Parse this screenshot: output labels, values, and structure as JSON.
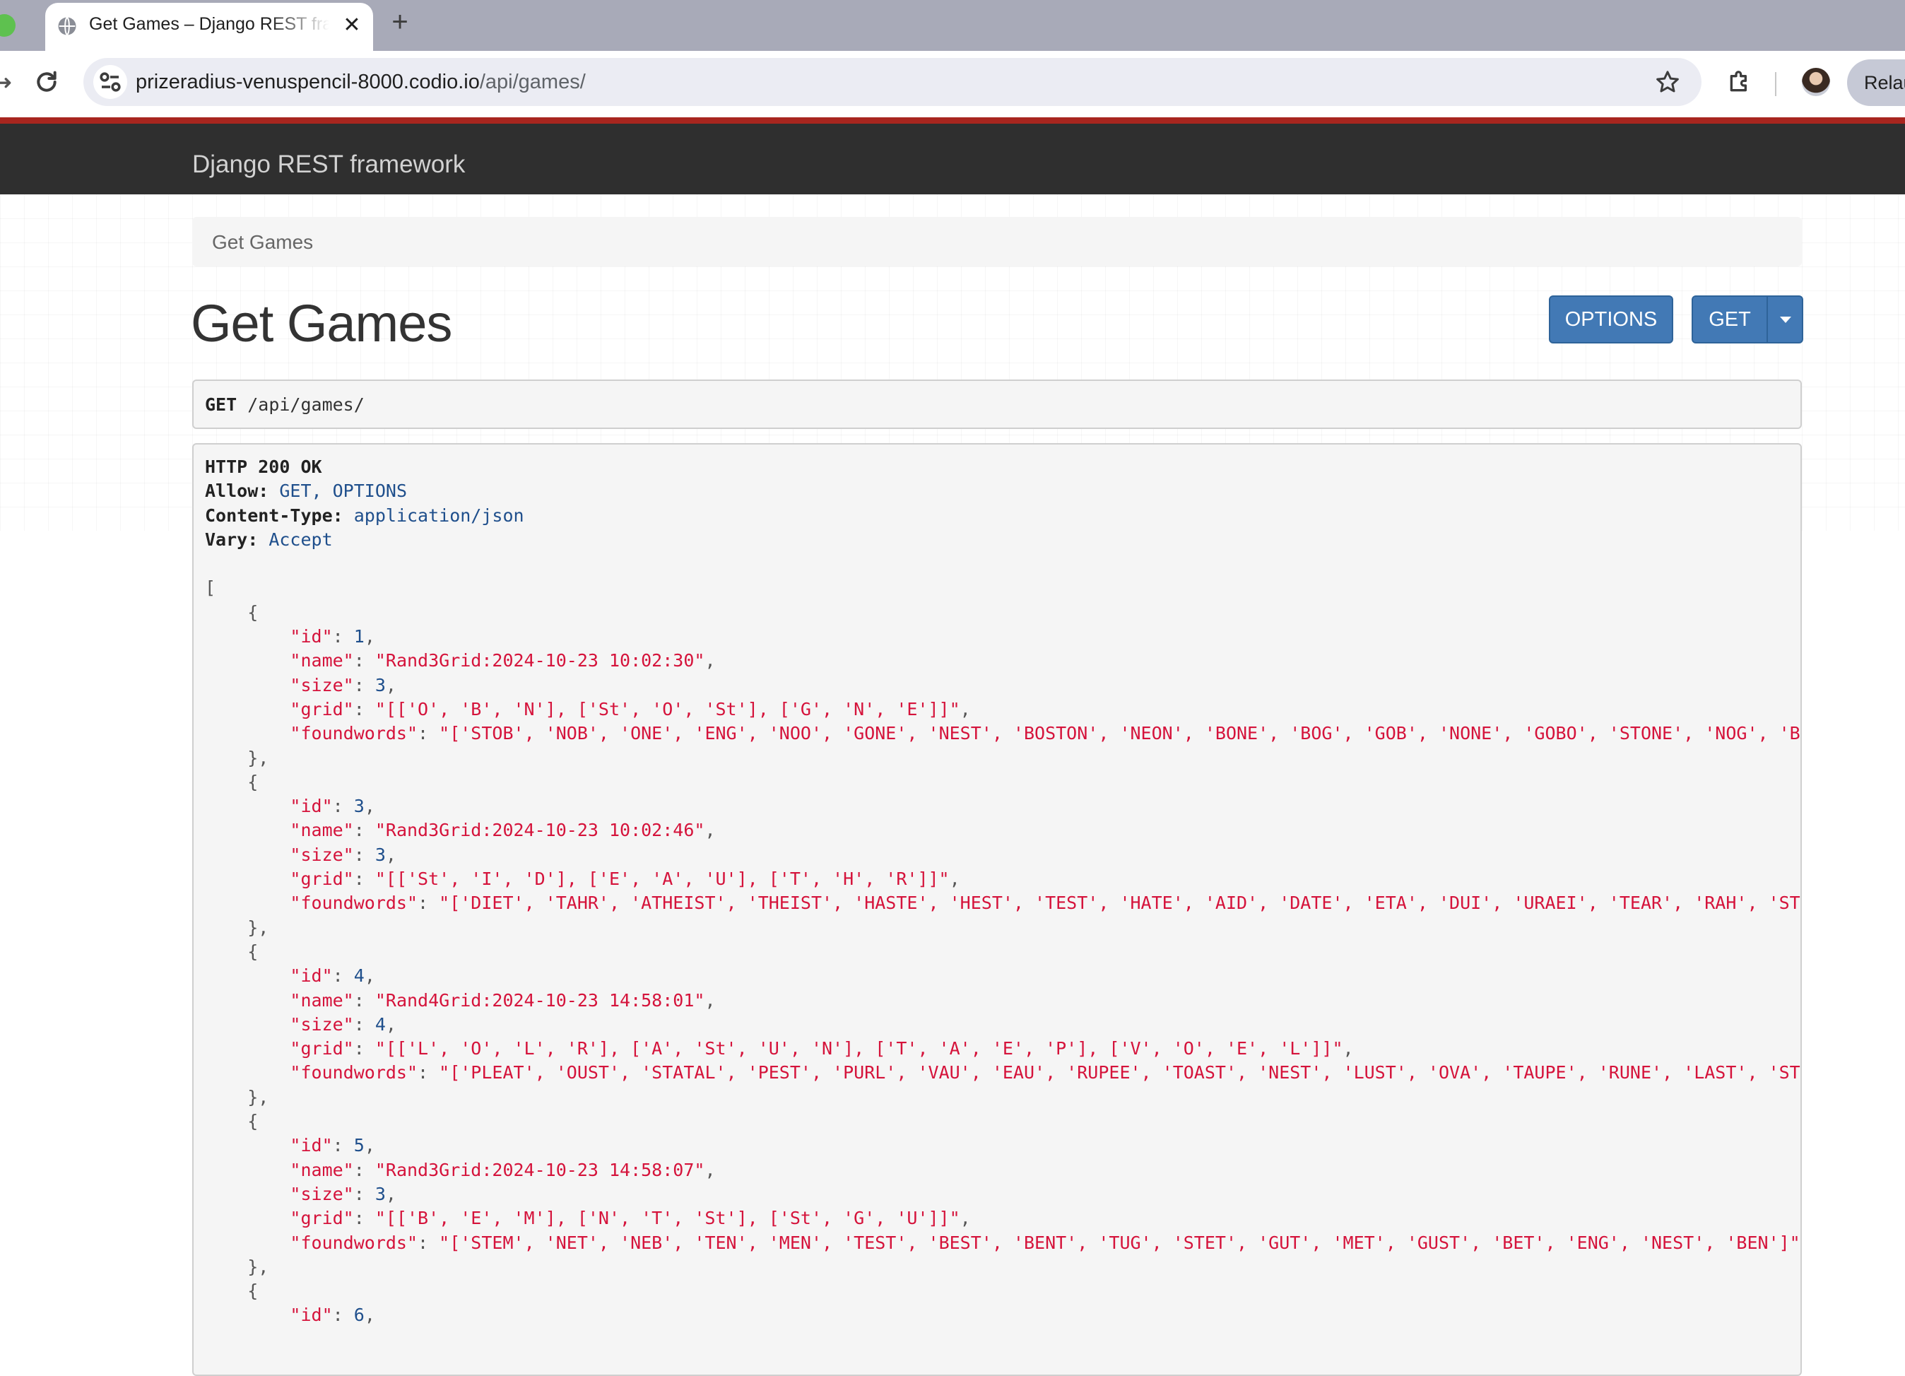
{
  "browser": {
    "tab_title": "Get Games – Django REST framework",
    "tab_close": "✕",
    "new_tab": "+",
    "url_host": "prizeradius-venuspencil-8000.codio.io",
    "url_path": "/api/games/",
    "relaunch_label": "Relaunch"
  },
  "navbar": {
    "brand": "Django REST framework"
  },
  "breadcrumb": {
    "item": "Get Games"
  },
  "page": {
    "title": "Get Games",
    "options_label": "OPTIONS",
    "get_label": "GET"
  },
  "request": {
    "method": "GET",
    "path": "/api/games/"
  },
  "response": {
    "status": "HTTP 200 OK",
    "headers": [
      {
        "name": "Allow:",
        "value": "GET, OPTIONS"
      },
      {
        "name": "Content-Type:",
        "value": "application/json"
      },
      {
        "name": "Vary:",
        "value": "Accept"
      }
    ],
    "games": [
      {
        "id": "1",
        "name": "\"Rand3Grid:2024-10-23 10:02:30\"",
        "size": "3",
        "grid": "\"[['O', 'B', 'N'], ['St', 'O', 'St'], ['G', 'N', 'E']]\"",
        "foundwords": "\"['STOB', 'NOB', 'ONE', 'ENG', 'NOO', 'GONE', 'NEST', 'BOSTON', 'NEON', 'BONE', 'BOG', 'GOB', 'NONE', 'GOBO', 'STONE', 'NOG', 'BONG', "
      },
      {
        "id": "3",
        "name": "\"Rand3Grid:2024-10-23 10:02:46\"",
        "size": "3",
        "grid": "\"[['St', 'I', 'D'], ['E', 'A', 'U'], ['T', 'H', 'R']]\"",
        "foundwords": "\"['DIET', 'TAHR', 'ATHEIST', 'THEIST', 'HASTE', 'HEST', 'TEST', 'HATE', 'AID', 'DATE', 'ETA', 'DUI', 'URAEI', 'TEAR', 'RAH', 'STET', 'R"
      },
      {
        "id": "4",
        "name": "\"Rand4Grid:2024-10-23 14:58:01\"",
        "size": "4",
        "grid": "\"[['L', 'O', 'L', 'R'], ['A', 'St', 'U', 'N'], ['T', 'A', 'E', 'P'], ['V', 'O', 'E', 'L']]\"",
        "foundwords": "\"['PLEAT', 'OUST', 'STATAL', 'PEST', 'PURL', 'VAU', 'EAU', 'RUPEE', 'TOAST', 'NEST', 'LUST', 'OVA', 'TAUPE', 'RUNE', 'LAST', 'STAT', 'E"
      },
      {
        "id": "5",
        "name": "\"Rand3Grid:2024-10-23 14:58:07\"",
        "size": "3",
        "grid": "\"[['B', 'E', 'M'], ['N', 'T', 'St'], ['St', 'G', 'U']]\"",
        "foundwords": "\"['STEM', 'NET', 'NEB', 'TEN', 'MEN', 'TEST', 'BEST', 'BENT', 'TUG', 'STET', 'GUT', 'MET', 'GUST', 'BET', 'ENG', 'NEST', 'BEN']\""
      },
      {
        "id": "6"
      }
    ]
  },
  "icons": {
    "favicon": "globe-icon",
    "reload": "reload-icon",
    "site_info": "tune-icon",
    "star": "star-icon",
    "extensions": "puzzle-icon",
    "caret": "caret-down-icon"
  },
  "colors": {
    "navbar_bg": "#2f2f2f",
    "navbar_accent": "#a8261f",
    "button_primary": "#4279b5",
    "json_string": "#d5133b",
    "json_literal": "#1f4f8c"
  }
}
